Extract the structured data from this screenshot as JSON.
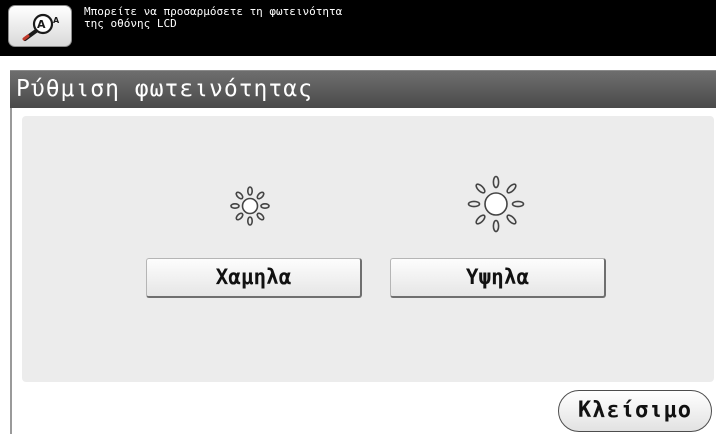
{
  "header": {
    "help_icon": "magnifier-accessibility-icon",
    "message_line1": "Μπορείτε να προσαρμόσετε τη φωτεινότητα",
    "message_line2": "της οθόνης LCD"
  },
  "screen": {
    "title": "Ρύθμιση φωτεινότητας"
  },
  "brightness": {
    "low_icon": "sun-small-icon",
    "high_icon": "sun-large-icon",
    "low_label": "Χαμηλα",
    "high_label": "Υψηλα"
  },
  "footer": {
    "close_label": "Κλείσιμο"
  },
  "colors": {
    "header_bg": "#000000",
    "title_bar_bg": "#5a5a5a",
    "panel_bg": "#ececec"
  }
}
